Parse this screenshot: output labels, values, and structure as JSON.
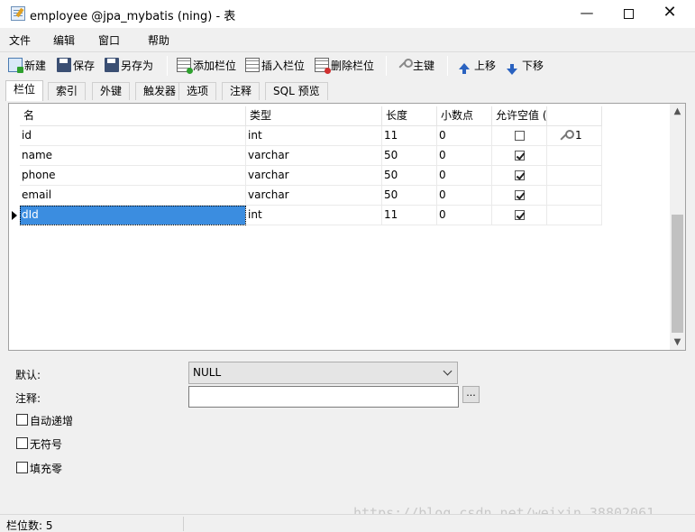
{
  "window": {
    "title": "employee @jpa_mybatis (ning) - 表",
    "minimize_glyph": "—",
    "close_glyph": "✕"
  },
  "menu": [
    "文件",
    "编辑",
    "窗口",
    "帮助"
  ],
  "toolbar": {
    "new": "新建",
    "save": "保存",
    "save_as": "另存为",
    "add_column": "添加栏位",
    "insert_column": "插入栏位",
    "delete_column": "删除栏位",
    "primary_key": "主键",
    "move_up": "上移",
    "move_down": "下移"
  },
  "tabs": [
    "栏位",
    "索引",
    "外键",
    "触发器",
    "选项",
    "注释",
    "SQL 预览"
  ],
  "active_tab": "栏位",
  "columns_header": [
    "名",
    "类型",
    "长度",
    "小数点",
    "允许空值 ("
  ],
  "rows": [
    {
      "name": "id",
      "type": "int",
      "length": "11",
      "decimals": "0",
      "nullable": false,
      "key": "1"
    },
    {
      "name": "name",
      "type": "varchar",
      "length": "50",
      "decimals": "0",
      "nullable": true,
      "key": ""
    },
    {
      "name": "phone",
      "type": "varchar",
      "length": "50",
      "decimals": "0",
      "nullable": true,
      "key": ""
    },
    {
      "name": "email",
      "type": "varchar",
      "length": "50",
      "decimals": "0",
      "nullable": true,
      "key": ""
    },
    {
      "name": "dId",
      "type": "int",
      "length": "11",
      "decimals": "0",
      "nullable": true,
      "key": ""
    }
  ],
  "selected_row": 4,
  "properties": {
    "default_label": "默认:",
    "default_value": "NULL",
    "comment_label": "注释:",
    "comment_value": "",
    "ellipsis": "...",
    "auto_increment": "自动递增",
    "unsigned": "无符号",
    "zerofill": "填充零"
  },
  "status": {
    "column_count": "栏位数: 5"
  },
  "watermark": "https://blog.csdn.net/weixin_38802061"
}
